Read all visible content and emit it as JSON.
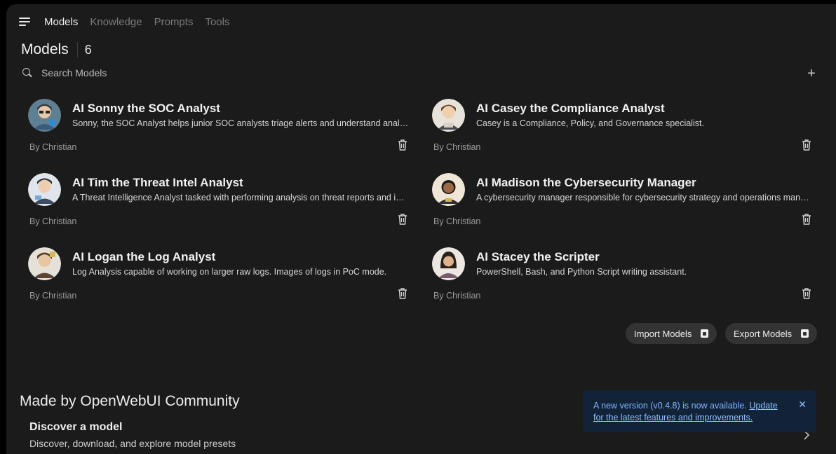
{
  "nav": {
    "tabs": [
      {
        "label": "Models"
      },
      {
        "label": "Knowledge"
      },
      {
        "label": "Prompts"
      },
      {
        "label": "Tools"
      }
    ]
  },
  "header": {
    "title": "Models",
    "count": "6"
  },
  "search": {
    "placeholder": "Search Models"
  },
  "models": [
    {
      "name": "AI Sonny the SOC Analyst",
      "description": "Sonny, the SOC Analyst helps junior SOC analysts triage alerts and understand analysis",
      "author": "By Christian"
    },
    {
      "name": "AI Casey the Compliance Analyst",
      "description": "Casey is a Compliance, Policy, and Governance specialist.",
      "author": "By Christian"
    },
    {
      "name": "AI Tim the Threat Intel Analyst",
      "description": "A Threat Intelligence Analyst tasked with performing analysis on threat reports and intel",
      "author": "By Christian"
    },
    {
      "name": "AI Madison the Cybersecurity Manager",
      "description": "A cybersecurity manager responsible for cybersecurity strategy and operations management",
      "author": "By Christian"
    },
    {
      "name": "AI Logan the Log Analyst",
      "description": "Log Analysis capable of working on larger raw logs. Images of logs in PoC mode.",
      "author": "By Christian"
    },
    {
      "name": "AI Stacey the Scripter",
      "description": "PowerShell, Bash, and Python Script writing assistant.",
      "author": "By Christian"
    }
  ],
  "actions": {
    "import_label": "Import Models",
    "export_label": "Export Models"
  },
  "community": {
    "title": "Made by OpenWebUI Community",
    "discover_title": "Discover a model",
    "discover_desc": "Discover, download, and explore model presets"
  },
  "toast": {
    "text": "A new version (v0.4.8) is now available. ",
    "link": "Update for the latest features and improvements."
  },
  "colors": {
    "background": "#1b1b1b",
    "toast_bg": "#122338",
    "toast_text": "#7fb4ff"
  }
}
